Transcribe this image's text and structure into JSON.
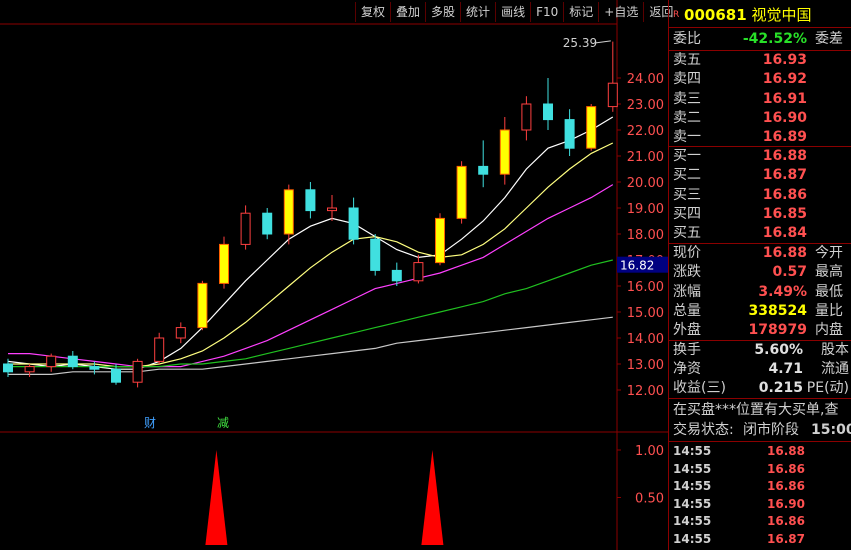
{
  "toolbar": [
    "复权",
    "叠加",
    "多股",
    "统计",
    "画线",
    "F10",
    "标记",
    "+自选",
    "返回"
  ],
  "stock": {
    "marker": "R",
    "code": "000681",
    "name": "视觉中国"
  },
  "commission": {
    "label": "委比",
    "value": "-42.52%",
    "label2": "委差"
  },
  "asks": [
    {
      "label": "卖五",
      "price": "16.93"
    },
    {
      "label": "卖四",
      "price": "16.92"
    },
    {
      "label": "卖三",
      "price": "16.91"
    },
    {
      "label": "卖二",
      "price": "16.90"
    },
    {
      "label": "卖一",
      "price": "16.89"
    }
  ],
  "bids": [
    {
      "label": "买一",
      "price": "16.88"
    },
    {
      "label": "买二",
      "price": "16.87"
    },
    {
      "label": "买三",
      "price": "16.86"
    },
    {
      "label": "买四",
      "price": "16.85"
    },
    {
      "label": "买五",
      "price": "16.84"
    }
  ],
  "quote": [
    {
      "label": "现价",
      "value": "16.88",
      "label2": "今开",
      "cls": "red"
    },
    {
      "label": "涨跌",
      "value": "0.57",
      "label2": "最高",
      "cls": "red"
    },
    {
      "label": "涨幅",
      "value": "3.49%",
      "label2": "最低",
      "cls": "red"
    },
    {
      "label": "总量",
      "value": "338524",
      "label2": "量比",
      "cls": "yellow"
    },
    {
      "label": "外盘",
      "value": "178979",
      "label2": "内盘",
      "cls": "red"
    }
  ],
  "stats": [
    {
      "label": "换手",
      "value": "5.60%",
      "label2": "股本"
    },
    {
      "label": "净资",
      "value": "4.71",
      "label2": "流通"
    },
    {
      "label": "收益(三)",
      "value": "0.215",
      "label2": "PE(动)"
    }
  ],
  "news": "在买盘***位置有大买单,查",
  "status": {
    "label": "交易状态:",
    "value": "闭市阶段",
    "time": "15:00:"
  },
  "ticks": [
    {
      "time": "14:55",
      "price": "16.88"
    },
    {
      "time": "14:55",
      "price": "16.86"
    },
    {
      "time": "14:55",
      "price": "16.86"
    },
    {
      "time": "14:55",
      "price": "16.90"
    },
    {
      "time": "14:55",
      "price": "16.86"
    },
    {
      "time": "14:55",
      "price": "16.87"
    }
  ],
  "chart_data": {
    "type": "candlestick",
    "y_ticks": [
      "24.00",
      "23.00",
      "22.00",
      "21.00",
      "20.00",
      "19.00",
      "18.00",
      "17.00",
      "16.00",
      "15.00",
      "14.00",
      "13.00",
      "12.00"
    ],
    "ylim": [
      11.5,
      25.5
    ],
    "current_price_label": "16.82",
    "high_annotation": "25.39",
    "event_markers": [
      "财",
      "减"
    ],
    "indicator_ticks": [
      "1.00",
      "0.50"
    ],
    "indicator_peaks": [
      {
        "index": 9,
        "value": 1.0
      },
      {
        "index": 19,
        "value": 1.0
      }
    ],
    "candles": [
      {
        "o": 13.0,
        "h": 13.2,
        "l": 12.5,
        "c": 12.7
      },
      {
        "o": 12.7,
        "h": 13.0,
        "l": 12.5,
        "c": 12.9
      },
      {
        "o": 12.9,
        "h": 13.4,
        "l": 12.7,
        "c": 13.3
      },
      {
        "o": 13.3,
        "h": 13.5,
        "l": 12.8,
        "c": 12.9
      },
      {
        "o": 12.9,
        "h": 13.1,
        "l": 12.6,
        "c": 12.8
      },
      {
        "o": 12.8,
        "h": 13.0,
        "l": 12.2,
        "c": 12.3
      },
      {
        "o": 12.3,
        "h": 13.2,
        "l": 12.1,
        "c": 13.1
      },
      {
        "o": 13.1,
        "h": 14.2,
        "l": 13.0,
        "c": 14.0
      },
      {
        "o": 14.0,
        "h": 14.6,
        "l": 13.8,
        "c": 14.4
      },
      {
        "o": 14.4,
        "h": 16.2,
        "l": 14.3,
        "c": 16.1
      },
      {
        "o": 16.1,
        "h": 17.9,
        "l": 15.9,
        "c": 17.6
      },
      {
        "o": 17.6,
        "h": 19.1,
        "l": 17.4,
        "c": 18.8
      },
      {
        "o": 18.8,
        "h": 19.0,
        "l": 17.8,
        "c": 18.0
      },
      {
        "o": 18.0,
        "h": 19.9,
        "l": 17.6,
        "c": 19.7
      },
      {
        "o": 19.7,
        "h": 20.0,
        "l": 18.6,
        "c": 18.9
      },
      {
        "o": 18.9,
        "h": 19.5,
        "l": 18.5,
        "c": 19.0
      },
      {
        "o": 19.0,
        "h": 19.4,
        "l": 17.6,
        "c": 17.8
      },
      {
        "o": 17.8,
        "h": 18.0,
        "l": 16.4,
        "c": 16.6
      },
      {
        "o": 16.6,
        "h": 16.9,
        "l": 16.0,
        "c": 16.2
      },
      {
        "o": 16.2,
        "h": 17.2,
        "l": 16.1,
        "c": 16.9
      },
      {
        "o": 16.9,
        "h": 18.8,
        "l": 16.8,
        "c": 18.6
      },
      {
        "o": 18.6,
        "h": 20.8,
        "l": 18.4,
        "c": 20.6
      },
      {
        "o": 20.6,
        "h": 21.6,
        "l": 19.8,
        "c": 20.3
      },
      {
        "o": 20.3,
        "h": 22.5,
        "l": 19.9,
        "c": 22.0
      },
      {
        "o": 22.0,
        "h": 23.3,
        "l": 21.6,
        "c": 23.0
      },
      {
        "o": 23.0,
        "h": 24.0,
        "l": 22.0,
        "c": 22.4
      },
      {
        "o": 22.4,
        "h": 22.8,
        "l": 21.0,
        "c": 21.3
      },
      {
        "o": 21.3,
        "h": 23.0,
        "l": 21.2,
        "c": 22.9
      },
      {
        "o": 22.9,
        "h": 25.4,
        "l": 22.7,
        "c": 23.8
      }
    ],
    "ma": [
      {
        "color": "#ffffff",
        "values": [
          13.1,
          13.0,
          12.9,
          13.0,
          12.9,
          12.8,
          12.8,
          13.1,
          13.6,
          14.4,
          15.3,
          16.2,
          17.0,
          17.8,
          18.3,
          18.6,
          18.4,
          17.9,
          17.4,
          17.1,
          17.2,
          17.8,
          18.5,
          19.4,
          20.5,
          21.3,
          21.6,
          22.0,
          22.5
        ]
      },
      {
        "color": "#ffff80",
        "values": [
          13.0,
          13.0,
          13.0,
          13.0,
          13.0,
          12.9,
          12.9,
          13.0,
          13.2,
          13.5,
          14.0,
          14.6,
          15.3,
          16.0,
          16.7,
          17.3,
          17.8,
          17.9,
          17.7,
          17.3,
          17.1,
          17.2,
          17.6,
          18.2,
          19.0,
          19.8,
          20.5,
          21.1,
          21.5
        ]
      },
      {
        "color": "#ff40ff",
        "values": [
          13.4,
          13.4,
          13.3,
          13.2,
          13.1,
          13.0,
          12.9,
          12.9,
          12.9,
          13.1,
          13.3,
          13.6,
          13.9,
          14.3,
          14.7,
          15.1,
          15.5,
          15.9,
          16.1,
          16.3,
          16.5,
          16.8,
          17.1,
          17.6,
          18.1,
          18.6,
          19.0,
          19.4,
          19.9
        ]
      },
      {
        "color": "#20c020",
        "values": [
          12.9,
          12.9,
          12.9,
          12.9,
          12.9,
          12.9,
          12.9,
          12.9,
          13.0,
          13.0,
          13.1,
          13.2,
          13.4,
          13.6,
          13.8,
          14.0,
          14.2,
          14.4,
          14.6,
          14.8,
          15.0,
          15.2,
          15.4,
          15.7,
          15.9,
          16.2,
          16.5,
          16.8,
          17.0
        ]
      },
      {
        "color": "#c8c8c8",
        "values": [
          12.6,
          12.6,
          12.6,
          12.7,
          12.7,
          12.7,
          12.7,
          12.8,
          12.8,
          12.8,
          12.9,
          13.0,
          13.1,
          13.2,
          13.3,
          13.4,
          13.5,
          13.6,
          13.8,
          13.9,
          14.0,
          14.1,
          14.2,
          14.3,
          14.4,
          14.5,
          14.6,
          14.7,
          14.8
        ]
      }
    ]
  }
}
